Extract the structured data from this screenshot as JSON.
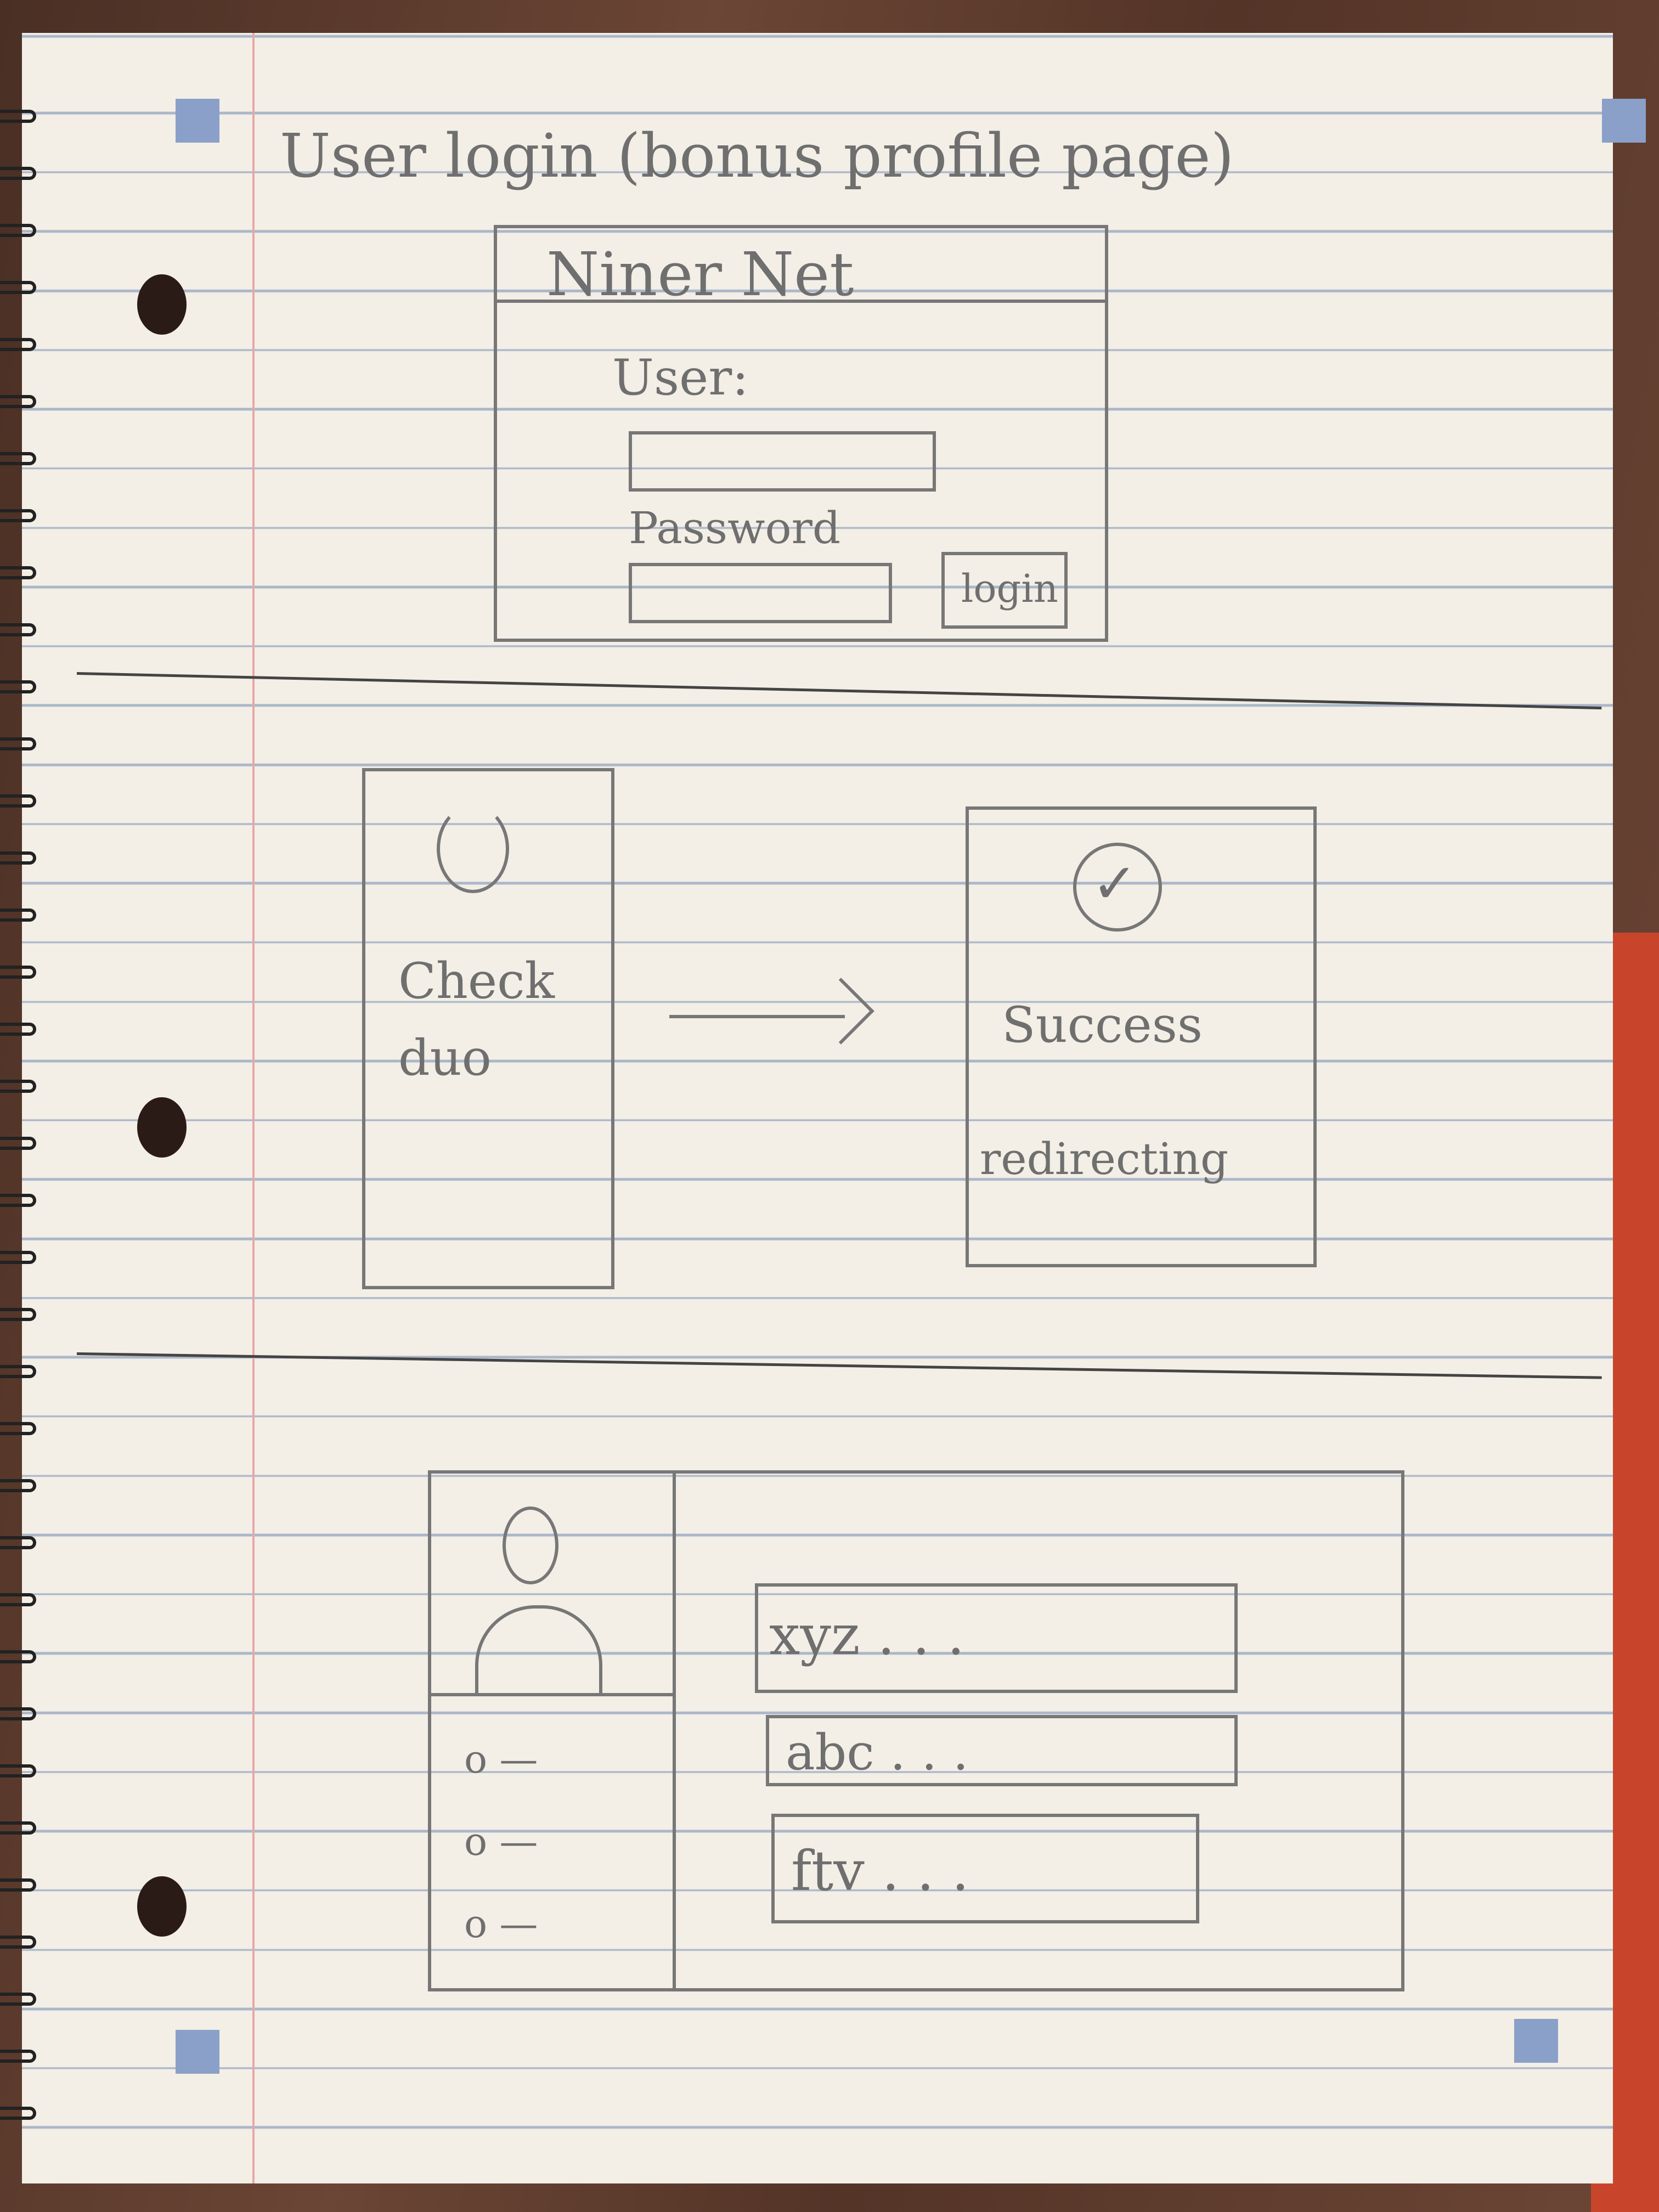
{
  "page_title": "User login (bonus profile page)",
  "login_sketch": {
    "app_name": "Niner Net",
    "user_label": "User:",
    "password_label": "Password",
    "login_button": "login"
  },
  "duo_sketch": {
    "duo_text_line1": "Check",
    "duo_text_line2": "duo",
    "success_text": "Success",
    "redirecting_text": "redirecting"
  },
  "profile_sketch": {
    "rows": [
      "xyz . . .",
      "abc . . .",
      "ftv . . ."
    ]
  }
}
